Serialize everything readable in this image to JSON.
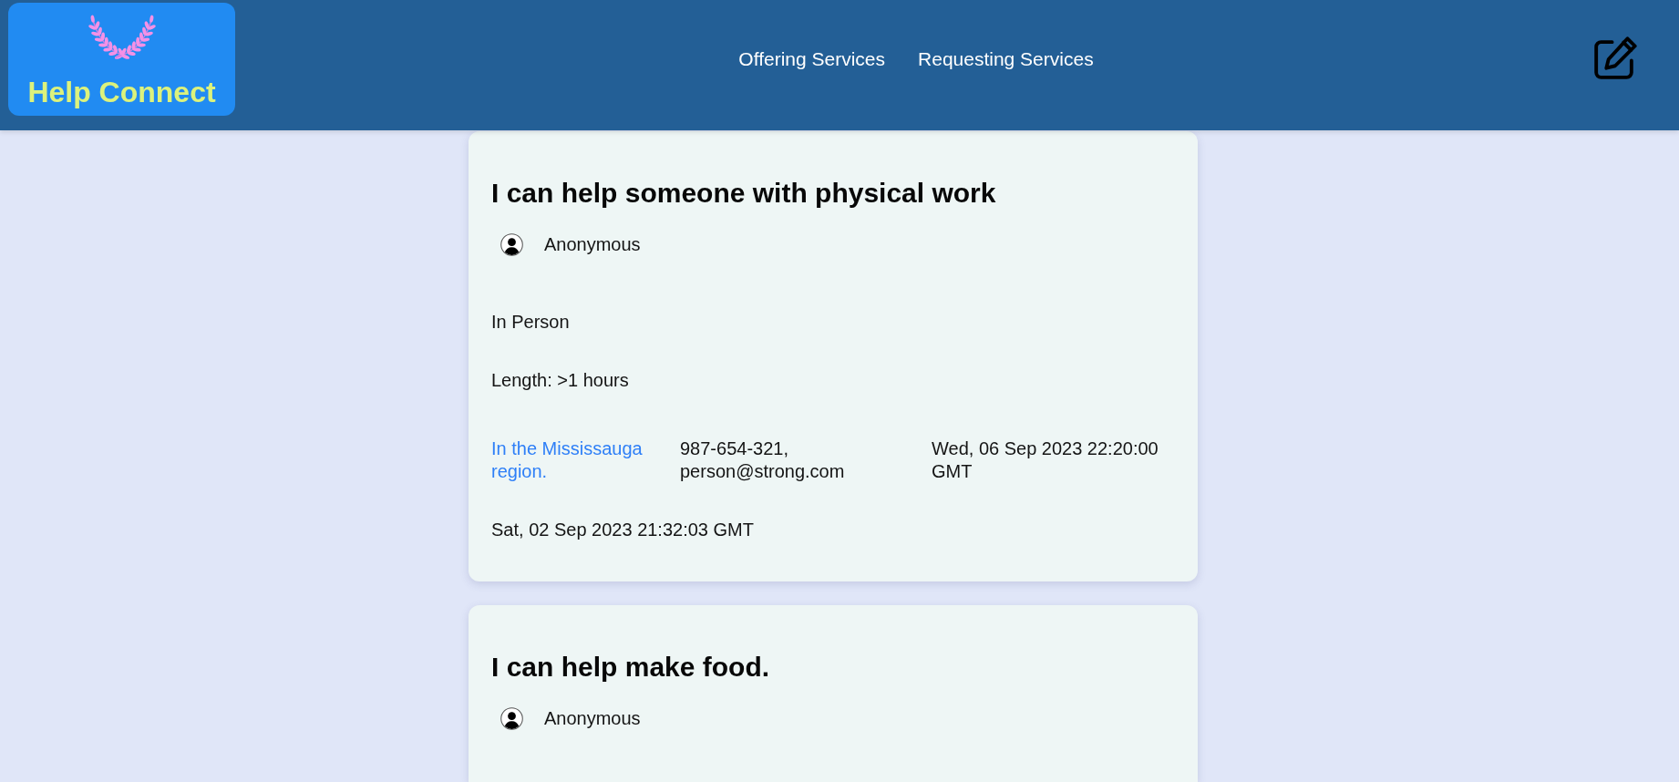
{
  "header": {
    "logo": {
      "text": "Help Connect"
    },
    "nav": [
      {
        "label": "Offering Services"
      },
      {
        "label": "Requesting Services"
      }
    ]
  },
  "posts": [
    {
      "title": "I can help someone with physical work",
      "author": "Anonymous",
      "mode": "In Person",
      "length": "Length: >1 hours",
      "location": "In the Mississauga region.",
      "contact": "987-654-321, person@strong.com",
      "date_1": "Wed, 06 Sep 2023 22:20:00 GMT",
      "date_2": "Sat, 02 Sep 2023 21:32:03 GMT"
    },
    {
      "title": "I can help make food.",
      "author": "Anonymous"
    }
  ]
}
